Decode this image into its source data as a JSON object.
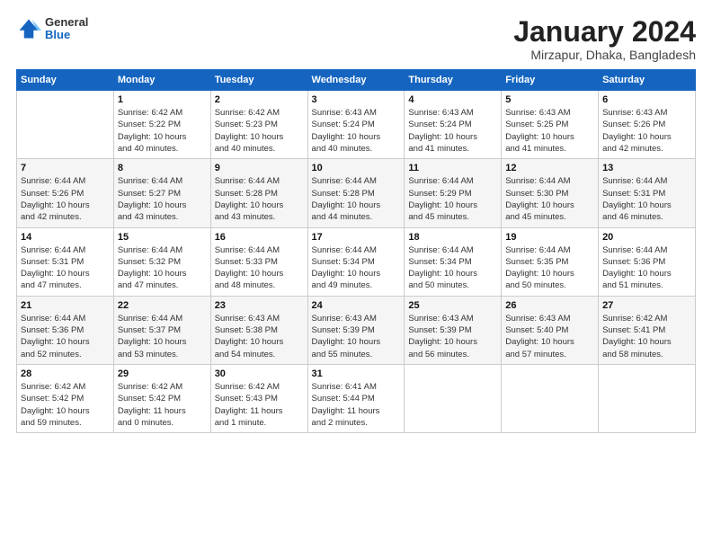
{
  "logo": {
    "general": "General",
    "blue": "Blue"
  },
  "title": "January 2024",
  "subtitle": "Mirzapur, Dhaka, Bangladesh",
  "days_header": [
    "Sunday",
    "Monday",
    "Tuesday",
    "Wednesday",
    "Thursday",
    "Friday",
    "Saturday"
  ],
  "weeks": [
    [
      {
        "day": "",
        "info": ""
      },
      {
        "day": "1",
        "info": "Sunrise: 6:42 AM\nSunset: 5:22 PM\nDaylight: 10 hours\nand 40 minutes."
      },
      {
        "day": "2",
        "info": "Sunrise: 6:42 AM\nSunset: 5:23 PM\nDaylight: 10 hours\nand 40 minutes."
      },
      {
        "day": "3",
        "info": "Sunrise: 6:43 AM\nSunset: 5:24 PM\nDaylight: 10 hours\nand 40 minutes."
      },
      {
        "day": "4",
        "info": "Sunrise: 6:43 AM\nSunset: 5:24 PM\nDaylight: 10 hours\nand 41 minutes."
      },
      {
        "day": "5",
        "info": "Sunrise: 6:43 AM\nSunset: 5:25 PM\nDaylight: 10 hours\nand 41 minutes."
      },
      {
        "day": "6",
        "info": "Sunrise: 6:43 AM\nSunset: 5:26 PM\nDaylight: 10 hours\nand 42 minutes."
      }
    ],
    [
      {
        "day": "7",
        "info": "Sunrise: 6:44 AM\nSunset: 5:26 PM\nDaylight: 10 hours\nand 42 minutes."
      },
      {
        "day": "8",
        "info": "Sunrise: 6:44 AM\nSunset: 5:27 PM\nDaylight: 10 hours\nand 43 minutes."
      },
      {
        "day": "9",
        "info": "Sunrise: 6:44 AM\nSunset: 5:28 PM\nDaylight: 10 hours\nand 43 minutes."
      },
      {
        "day": "10",
        "info": "Sunrise: 6:44 AM\nSunset: 5:28 PM\nDaylight: 10 hours\nand 44 minutes."
      },
      {
        "day": "11",
        "info": "Sunrise: 6:44 AM\nSunset: 5:29 PM\nDaylight: 10 hours\nand 45 minutes."
      },
      {
        "day": "12",
        "info": "Sunrise: 6:44 AM\nSunset: 5:30 PM\nDaylight: 10 hours\nand 45 minutes."
      },
      {
        "day": "13",
        "info": "Sunrise: 6:44 AM\nSunset: 5:31 PM\nDaylight: 10 hours\nand 46 minutes."
      }
    ],
    [
      {
        "day": "14",
        "info": "Sunrise: 6:44 AM\nSunset: 5:31 PM\nDaylight: 10 hours\nand 47 minutes."
      },
      {
        "day": "15",
        "info": "Sunrise: 6:44 AM\nSunset: 5:32 PM\nDaylight: 10 hours\nand 47 minutes."
      },
      {
        "day": "16",
        "info": "Sunrise: 6:44 AM\nSunset: 5:33 PM\nDaylight: 10 hours\nand 48 minutes."
      },
      {
        "day": "17",
        "info": "Sunrise: 6:44 AM\nSunset: 5:34 PM\nDaylight: 10 hours\nand 49 minutes."
      },
      {
        "day": "18",
        "info": "Sunrise: 6:44 AM\nSunset: 5:34 PM\nDaylight: 10 hours\nand 50 minutes."
      },
      {
        "day": "19",
        "info": "Sunrise: 6:44 AM\nSunset: 5:35 PM\nDaylight: 10 hours\nand 50 minutes."
      },
      {
        "day": "20",
        "info": "Sunrise: 6:44 AM\nSunset: 5:36 PM\nDaylight: 10 hours\nand 51 minutes."
      }
    ],
    [
      {
        "day": "21",
        "info": "Sunrise: 6:44 AM\nSunset: 5:36 PM\nDaylight: 10 hours\nand 52 minutes."
      },
      {
        "day": "22",
        "info": "Sunrise: 6:44 AM\nSunset: 5:37 PM\nDaylight: 10 hours\nand 53 minutes."
      },
      {
        "day": "23",
        "info": "Sunrise: 6:43 AM\nSunset: 5:38 PM\nDaylight: 10 hours\nand 54 minutes."
      },
      {
        "day": "24",
        "info": "Sunrise: 6:43 AM\nSunset: 5:39 PM\nDaylight: 10 hours\nand 55 minutes."
      },
      {
        "day": "25",
        "info": "Sunrise: 6:43 AM\nSunset: 5:39 PM\nDaylight: 10 hours\nand 56 minutes."
      },
      {
        "day": "26",
        "info": "Sunrise: 6:43 AM\nSunset: 5:40 PM\nDaylight: 10 hours\nand 57 minutes."
      },
      {
        "day": "27",
        "info": "Sunrise: 6:42 AM\nSunset: 5:41 PM\nDaylight: 10 hours\nand 58 minutes."
      }
    ],
    [
      {
        "day": "28",
        "info": "Sunrise: 6:42 AM\nSunset: 5:42 PM\nDaylight: 10 hours\nand 59 minutes."
      },
      {
        "day": "29",
        "info": "Sunrise: 6:42 AM\nSunset: 5:42 PM\nDaylight: 11 hours\nand 0 minutes."
      },
      {
        "day": "30",
        "info": "Sunrise: 6:42 AM\nSunset: 5:43 PM\nDaylight: 11 hours\nand 1 minute."
      },
      {
        "day": "31",
        "info": "Sunrise: 6:41 AM\nSunset: 5:44 PM\nDaylight: 11 hours\nand 2 minutes."
      },
      {
        "day": "",
        "info": ""
      },
      {
        "day": "",
        "info": ""
      },
      {
        "day": "",
        "info": ""
      }
    ]
  ]
}
